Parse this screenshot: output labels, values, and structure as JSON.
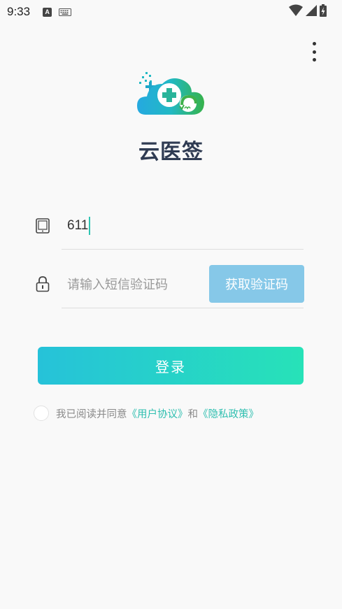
{
  "status_bar": {
    "time": "9:33",
    "icons": [
      "a-icon",
      "keyboard-icon",
      "wifi-icon",
      "signal-icon",
      "battery-icon"
    ]
  },
  "app": {
    "title": "云医签",
    "logo": "cloud-medical-logo"
  },
  "form": {
    "phone_icon": "tablet-icon",
    "phone_value": "611",
    "code_icon": "lock-icon",
    "code_placeholder": "请输入短信验证码",
    "get_code_label": "获取验证码",
    "login_label": "登录"
  },
  "agreement": {
    "prefix": "我已阅读并同意",
    "user_agreement": "《用户协议》",
    "and": "和",
    "privacy_policy": "《隐私政策》"
  },
  "colors": {
    "accent": "#2fbfb0",
    "title": "#2f3b52",
    "get_code_bg": "#86c8e8",
    "login_gradient_start": "#26c2d9",
    "login_gradient_end": "#27e2b8"
  }
}
